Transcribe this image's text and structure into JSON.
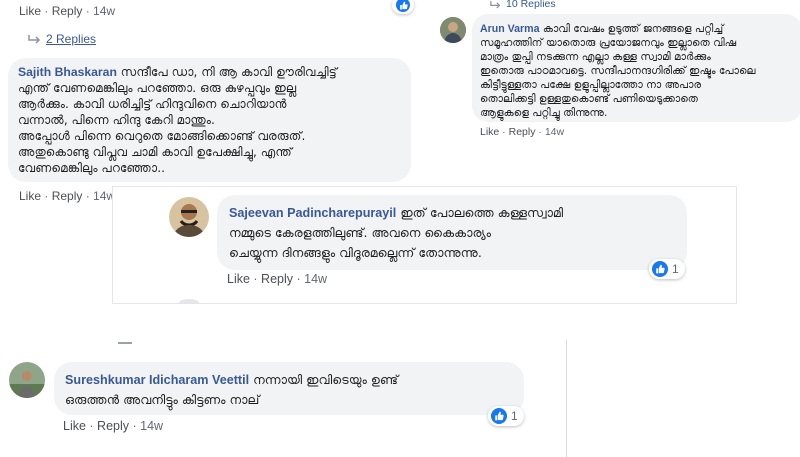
{
  "top_left": {
    "actions": {
      "like": "Like",
      "reply": "Reply",
      "time": "14w"
    },
    "replies_link": "2 Replies"
  },
  "sajith": {
    "author": "Sajith Bhaskaran",
    "lines": [
      " സന്ദീപേ ഡാ, നി ആ കാവി ഊരിവച്ചിട്ട്",
      "എന്ത് വേണമെങ്കിലും പറഞ്ഞോ. ഒരു കുഴപ്പവും ഇല്ല",
      "ആർക്കും. കാവി ധരിച്ചിട്ട് ഹിന്ദുവിനെ ചൊറിയാൻ",
      "വന്നാൽ, പിന്നെ ഹിന്ദു കേറി മാന്തും.",
      "അപ്പോൾ പിന്നെ വെറുതെ മോങ്ങിക്കൊണ്ട് വരരുത്.",
      "അതുകൊണ്ടു വിപ്ലവ ചാമി കാവി ഉപേക്ഷിച്ചു, എന്ത്",
      "വേണമെങ്കിലും പറഞ്ഞോ.."
    ],
    "actions": {
      "like": "Like",
      "reply": "Reply",
      "time": "14w"
    }
  },
  "arun": {
    "replies_link": "10 Replies",
    "author": "Arun Varma",
    "lines": [
      " കാവി വേഷം ഉടുത്ത് ജനങ്ങളെ പറ്റിച്ച്",
      "സമൂഹത്തിന് യാതൊരു പ്രയോജനവും ഇല്ലാതെ വിഷ",
      "മാത്രം തുപ്പി നടക്കുന്ന എല്ലാ കള്ള സ്വാമി മാർക്കും",
      "ഇതൊരു പാഠമാവട്ടെ. സന്ദീപാനന്ദഗിരിക്ക് ഇഷ്ടം പോലെ",
      "കിട്ടീട്ടുള്ളതാ പക്ഷേ ഉളുപ്പില്ലാത്തോ നാ അപാര",
      "തൊലിക്കട്ടി ഉള്ളതുകൊണ്ട് പണിയെടുക്കാതെ",
      "ആളുകളെ പറ്റിച്ചു തിന്നുന്നു."
    ],
    "actions": {
      "like": "Like",
      "reply": "Reply",
      "time": "14w"
    }
  },
  "sajeevan": {
    "author": "Sajeevan Padincharepurayil",
    "lines": [
      " ഇത് പോലത്തെ കള്ളസ്വാമി",
      "നമ്മുടെ കേരളത്തിലുണ്ട്. അവനെ കൈകാര്യം",
      "ചെയ്യുന്ന ദിനങ്ങളും വിദൂരമല്ലെന്ന് തോന്നുന്നു."
    ],
    "actions": {
      "like": "Like",
      "reply": "Reply",
      "time": "14w"
    },
    "reaction_count": "1"
  },
  "suresh": {
    "author": "Sureshkumar Idicharam Veettil",
    "lines": [
      " നന്നായി ഇവിടെയും ഉണ്ട്",
      "ഒരുത്തൻ അവനിട്ടും കിട്ടണം നാല്"
    ],
    "actions": {
      "like": "Like",
      "reply": "Reply",
      "time": "14w"
    },
    "reaction_count": "1"
  },
  "colors": {
    "link": "#385898",
    "bubble": "#f2f3f5",
    "like_blue": "#1877f2",
    "meta": "#606770"
  },
  "icons": {
    "reply_arrow": "reply-arrow-icon",
    "like": "thumbs-up-icon"
  }
}
